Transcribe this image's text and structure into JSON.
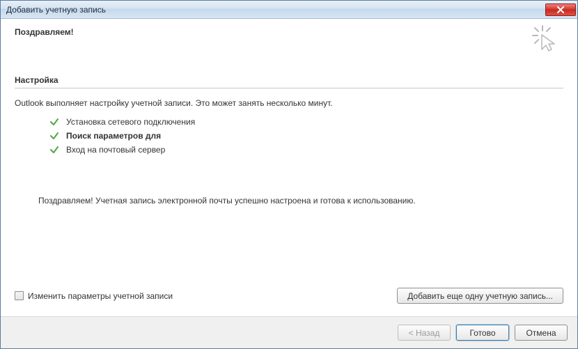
{
  "window": {
    "title": "Добавить учетную запись"
  },
  "header": {
    "title": "Поздравляем!"
  },
  "section": {
    "title": "Настройка",
    "intro": "Outlook выполняет настройку учетной записи. Это может занять несколько минут."
  },
  "steps": [
    {
      "label": "Установка сетевого подключения",
      "bold": false
    },
    {
      "label": "Поиск параметров для",
      "bold": true
    },
    {
      "label": "Вход на почтовый сервер",
      "bold": false
    }
  ],
  "success": "Поздравляем! Учетная запись электронной почты успешно настроена и готова к использованию.",
  "change_settings": {
    "label": "Изменить параметры учетной записи"
  },
  "buttons": {
    "add_another": "Добавить еще одну учетную запись...",
    "back": "< Назад",
    "finish": "Готово",
    "cancel": "Отмена"
  }
}
